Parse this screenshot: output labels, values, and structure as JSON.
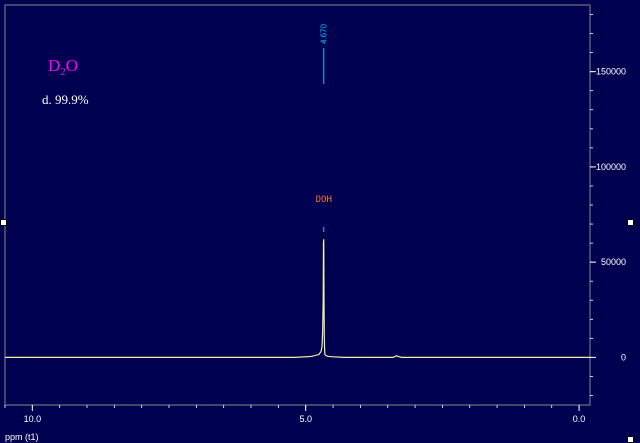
{
  "chart_data": {
    "type": "line",
    "solvent_label": {
      "main": "D",
      "sub": "2",
      "tail": "O"
    },
    "deuteration_label": "d. 99.9%",
    "peak_pick_label": "4.670",
    "peak_assignment_label": "DOH",
    "xlabel": "ppm (t1)",
    "x_ticks": [
      "10.0",
      "5.0",
      "0.0"
    ],
    "y_ticks": [
      "150000",
      "100000",
      "50000",
      "0"
    ],
    "xlim": [
      10.5,
      -0.2
    ],
    "ylim": [
      -25000,
      185000
    ],
    "x_reversed": true,
    "grid": false,
    "series": [
      {
        "color": "#f5f0a0",
        "x": [
          10.5,
          5.2,
          4.9,
          4.76,
          4.72,
          4.7,
          4.69,
          4.68,
          4.675,
          4.67,
          4.665,
          4.66,
          4.655,
          4.65,
          4.64,
          4.62,
          4.58,
          4.5,
          4.3,
          3.4,
          3.36,
          3.33,
          3.3,
          3.25,
          2.0,
          -0.2
        ],
        "y": [
          0,
          0,
          500,
          1500,
          3000,
          6000,
          14000,
          30000,
          60000,
          62000,
          30000,
          12000,
          5000,
          1500,
          1200,
          800,
          500,
          300,
          0,
          0,
          600,
          800,
          400,
          0,
          0,
          0
        ]
      }
    ]
  },
  "colors": {
    "background": "#000050",
    "frame": "#5a5a78",
    "axis_text": "#ffffff",
    "trace": "#f5f0a0",
    "solvent_text": "#ff00ff",
    "peak_pick": "#00c8ff",
    "assignment_text": "#ff6a2a"
  }
}
